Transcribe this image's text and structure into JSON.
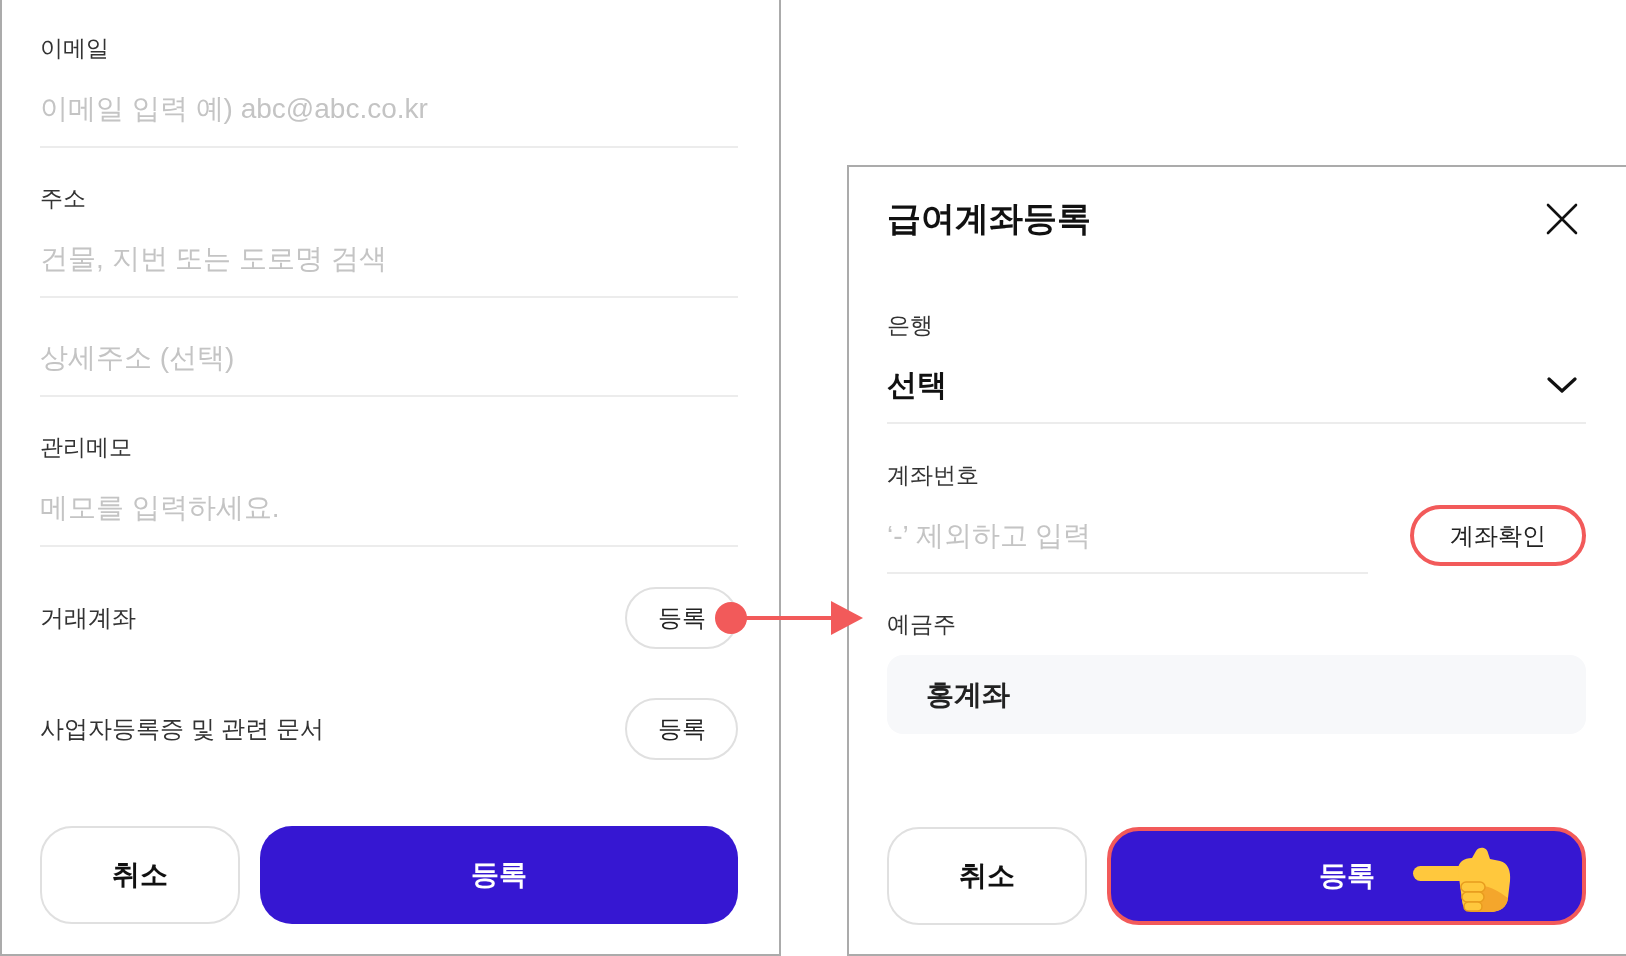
{
  "left_form": {
    "fields": [
      {
        "kind": "text",
        "label": "이메일",
        "placeholder": "이메일 입력 예) abc@abc.co.kr"
      },
      {
        "kind": "text",
        "label": "주소",
        "placeholder": "건물, 지번 또는 도로명 검색"
      },
      {
        "kind": "text",
        "placeholder": "상세주소 (선택)"
      },
      {
        "kind": "text",
        "label": "관리메모",
        "placeholder": "메모를 입력하세요."
      },
      {
        "kind": "action",
        "label": "거래계좌",
        "button": "등록",
        "annotated": true
      },
      {
        "kind": "action",
        "label": "사업자등록증 및 관련 문서",
        "button": "등록",
        "annotated": false
      }
    ],
    "buttons": [
      {
        "kind": "secondary",
        "label": "취소",
        "highlighted": false,
        "pointer": false
      },
      {
        "kind": "primary",
        "label": "등록",
        "highlighted": false,
        "pointer": false
      }
    ]
  },
  "dialog": {
    "title": "급여계좌등록",
    "fields": [
      {
        "kind": "select",
        "label": "은행",
        "value": "선택"
      },
      {
        "kind": "input_button",
        "label": "계좌번호",
        "placeholder": "‘-’ 제외하고 입력",
        "button": {
          "label": "계좌확인",
          "highlighted": true
        }
      },
      {
        "kind": "readonly",
        "label": "예금주",
        "value": "홍계좌"
      }
    ],
    "buttons": [
      {
        "kind": "secondary",
        "label": "취소",
        "highlighted": false,
        "pointer": false
      },
      {
        "kind": "primary",
        "label": "등록",
        "highlighted": true,
        "pointer": true
      }
    ]
  }
}
